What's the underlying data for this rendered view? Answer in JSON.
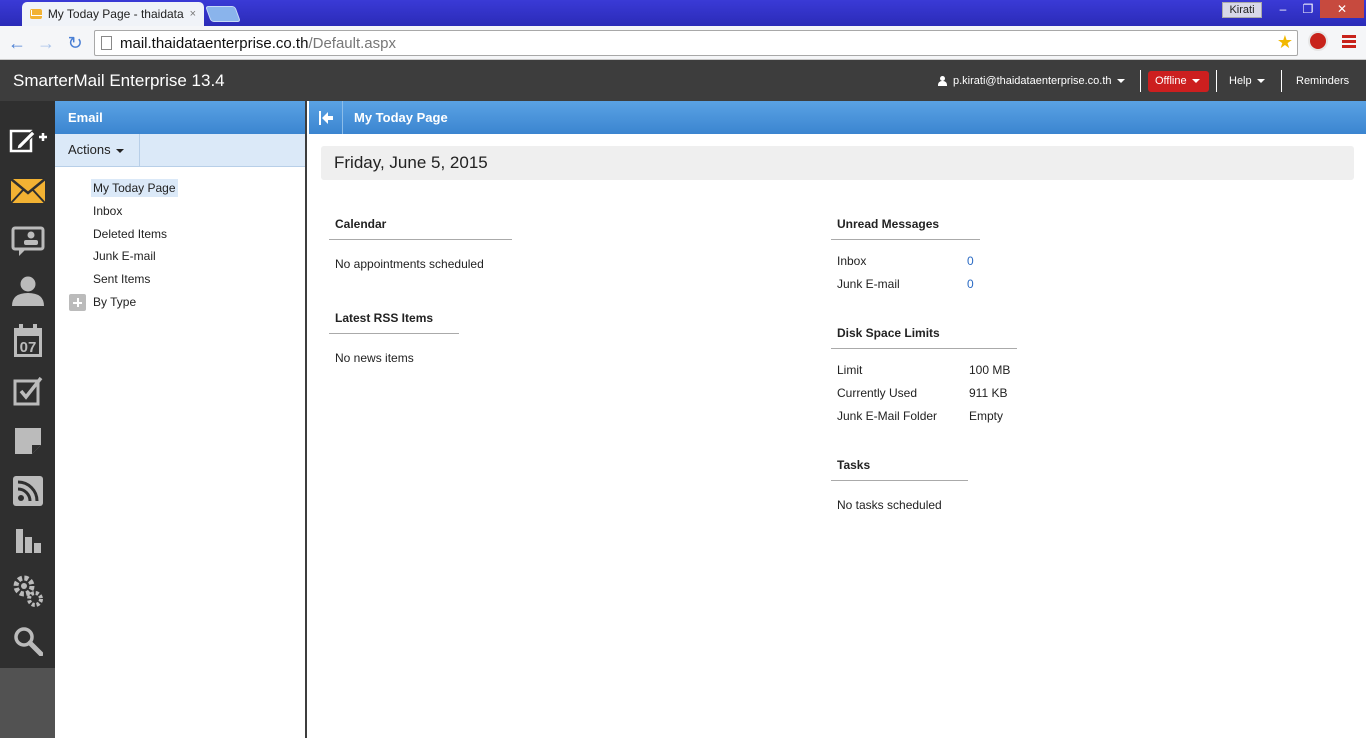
{
  "browser": {
    "tab_title": "My Today Page - thaidata",
    "tab_close": "×",
    "window_user": "Kirati",
    "win_minimize": "–",
    "win_restore": "❐",
    "win_close": "✕",
    "url_host": "mail.thaidataenterprise.co.th",
    "url_path": "/Default.aspx",
    "back_glyph": "←",
    "forward_glyph": "→",
    "reload_glyph": "↻",
    "star_glyph": "★"
  },
  "header": {
    "app_title": "SmarterMail Enterprise 13.4",
    "user_email": "p.kirati@thaidataenterprise.co.th",
    "status_label": "Offline",
    "help_label": "Help",
    "reminders_label": "Reminders"
  },
  "folder_panel": {
    "title": "Email",
    "actions_label": "Actions",
    "items": [
      {
        "label": "My Today Page"
      },
      {
        "label": "Inbox"
      },
      {
        "label": "Deleted Items"
      },
      {
        "label": "Junk E-mail"
      },
      {
        "label": "Sent Items"
      },
      {
        "label": "By Type"
      }
    ]
  },
  "main": {
    "title": "My Today Page",
    "date": "Friday, June 5, 2015",
    "calendar": {
      "title": "Calendar",
      "empty": "No appointments scheduled"
    },
    "rss": {
      "title": "Latest RSS Items",
      "empty": "No news items"
    },
    "unread": {
      "title": "Unread Messages",
      "rows": [
        {
          "label": "Inbox",
          "value": "0"
        },
        {
          "label": "Junk E-mail",
          "value": "0"
        }
      ]
    },
    "disk": {
      "title": "Disk Space Limits",
      "rows": [
        {
          "label": "Limit",
          "value": "100 MB"
        },
        {
          "label": "Currently Used",
          "value": "911 KB"
        },
        {
          "label": "Junk E-Mail Folder",
          "value": "Empty"
        }
      ]
    },
    "tasks": {
      "title": "Tasks",
      "empty": "No tasks scheduled"
    }
  },
  "colors": {
    "header_bg": "#3d3d3d",
    "panel_blue": "#4a93db",
    "offline_red": "#cc1f1f",
    "link_blue": "#2b6bc4"
  }
}
